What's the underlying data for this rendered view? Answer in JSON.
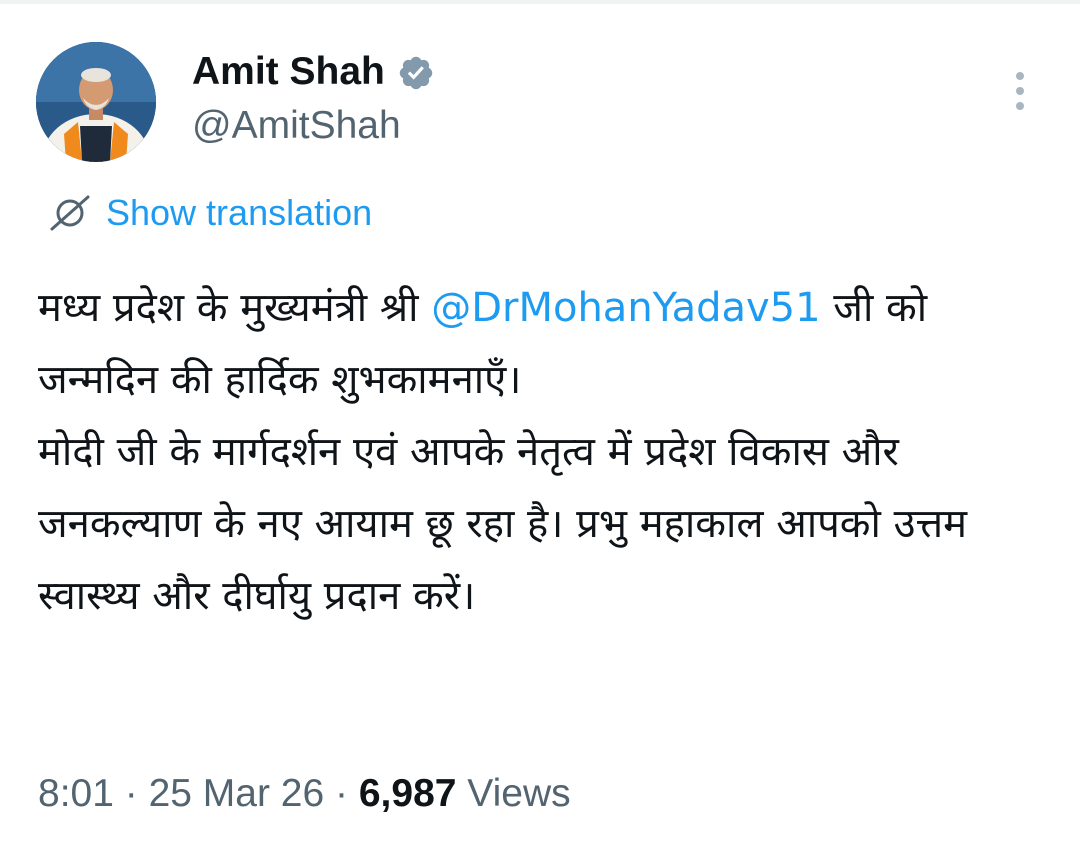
{
  "author": {
    "display_name": "Amit Shah",
    "handle": "@AmitShah",
    "verified": true,
    "verified_badge_color": "#829aab"
  },
  "actions": {
    "more_icon": "more-vertical-icon",
    "translate_icon": "globe-translate-icon",
    "show_translation_label": "Show translation"
  },
  "tweet": {
    "line1_prefix": "मध्य प्रदेश के मुख्यमंत्री श्री ",
    "mention": "@DrMohanYadav51",
    "line1_suffix": " जी को जन्मदिन की हार्दिक शुभकामनाएँ।",
    "paragraph2": "मोदी जी के मार्गदर्शन एवं आपके नेतृत्व में प्रदेश विकास और जनकल्याण के नए आयाम छू रहा है। प्रभु महाकाल आपको उत्तम स्वास्थ्य और दीर्घायु प्रदान करें।"
  },
  "meta": {
    "time": "8:01",
    "separator": " · ",
    "date": "25 Mar 26",
    "views_count": "6,987",
    "views_label": " Views"
  },
  "colors": {
    "link": "#1d9bf0",
    "secondary_text": "#536471",
    "primary_text": "#0f1419"
  }
}
